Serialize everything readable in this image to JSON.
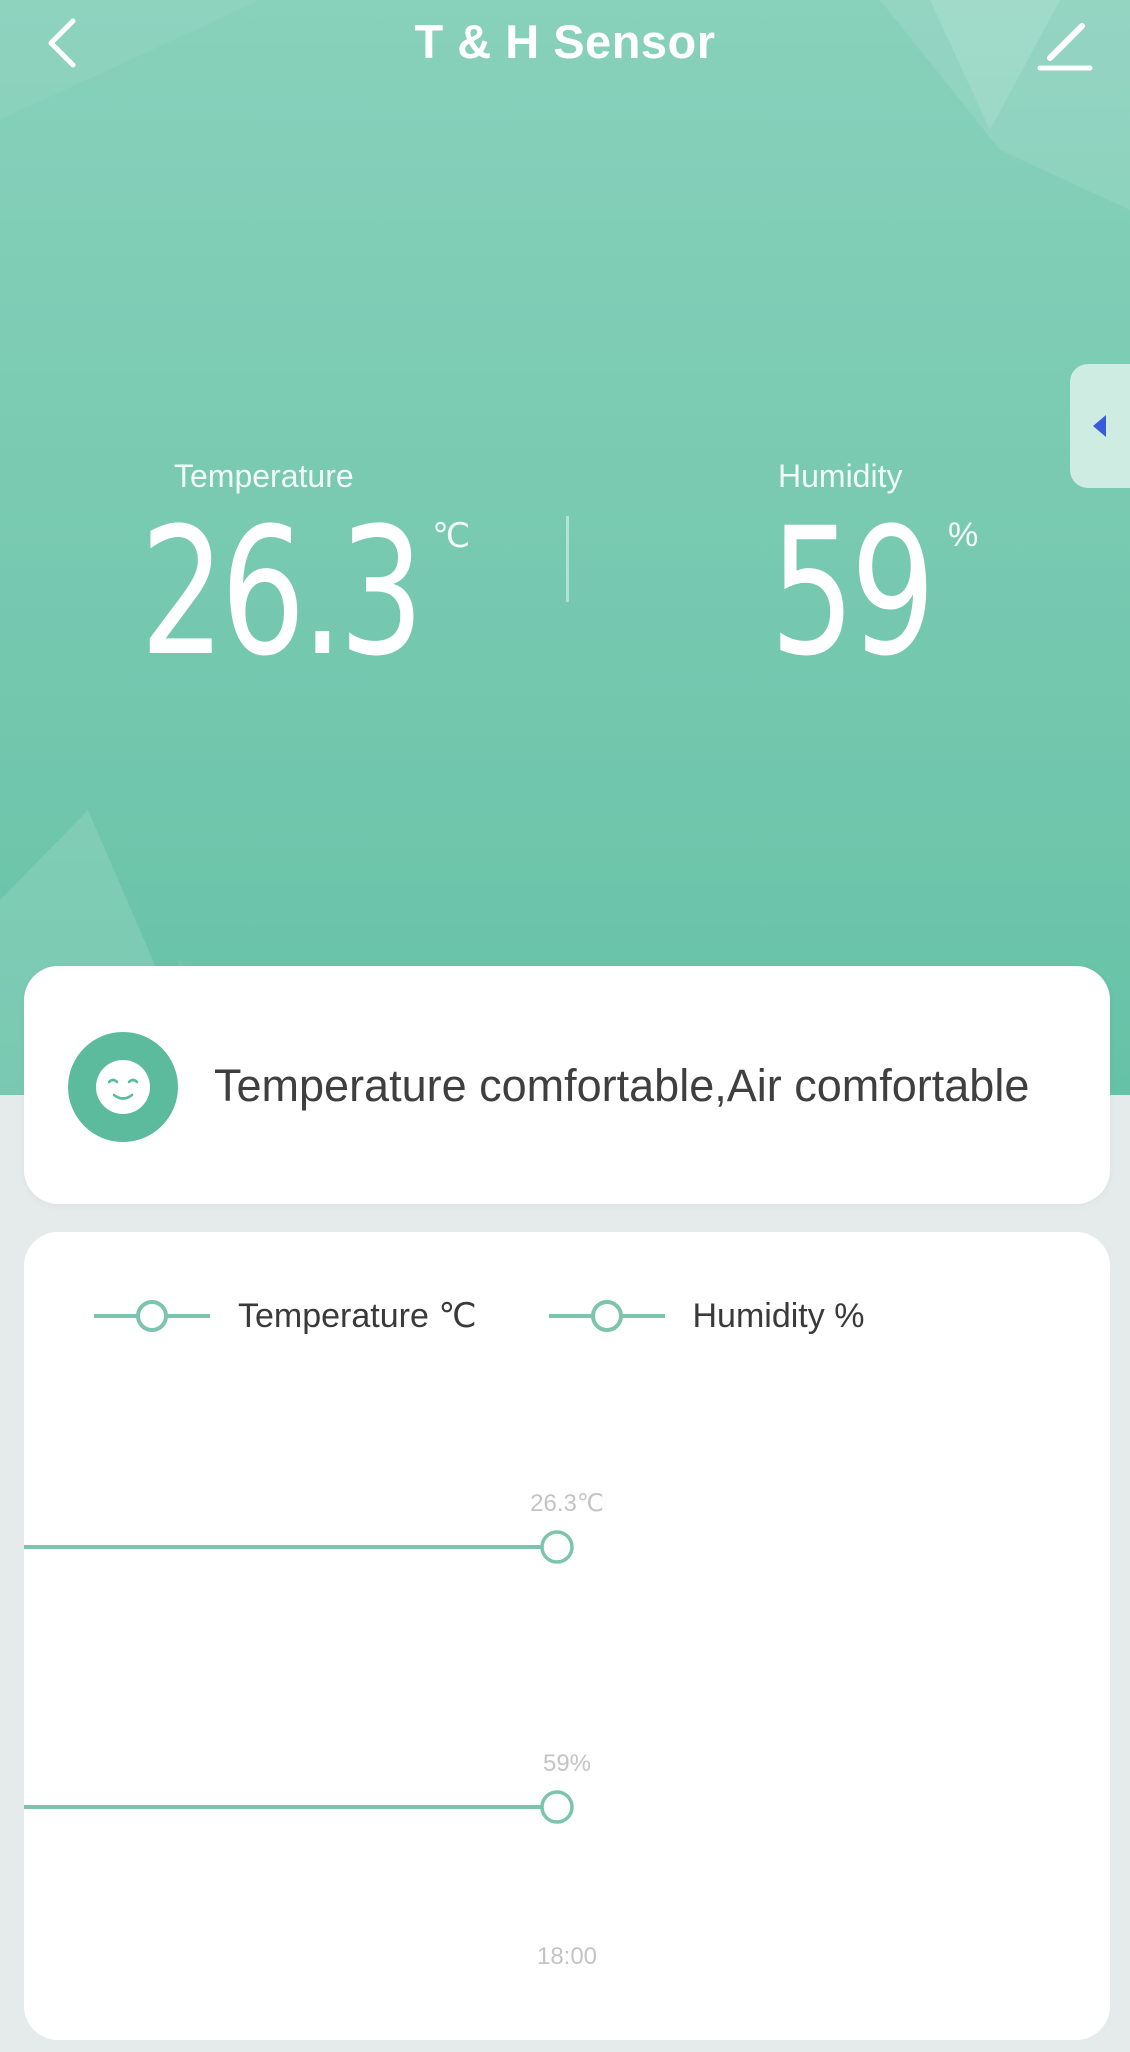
{
  "header": {
    "title": "T & H Sensor",
    "back_icon": "chevron-left-icon",
    "edit_icon": "pencil-icon",
    "side_tab_icon": "caret-left-icon"
  },
  "readings": {
    "temperature": {
      "label": "Temperature",
      "value": "26.3",
      "unit": "℃"
    },
    "humidity": {
      "label": "Humidity",
      "value": "59",
      "unit": "%"
    }
  },
  "comfort": {
    "icon": "smiley-face-icon",
    "text": "Temperature comfortable,Air comfortable"
  },
  "chart": {
    "legend": [
      {
        "label": "Temperature ℃"
      },
      {
        "label": "Humidity %"
      }
    ]
  },
  "chart_data": {
    "type": "line",
    "series": [
      {
        "name": "Temperature ℃",
        "x": [
          "18:00"
        ],
        "values": [
          26.3
        ],
        "point_label": "26.3℃"
      },
      {
        "name": "Humidity %",
        "x": [
          "18:00"
        ],
        "values": [
          59
        ],
        "point_label": "59%"
      }
    ],
    "x_tick_labels": [
      "18:00"
    ],
    "grid": false,
    "legend_position": "top-left"
  },
  "colors": {
    "accent": "#5bbb9c",
    "line": "#7cc4ad",
    "hero_top": "#88d1bb",
    "hero_bottom": "#66c2a6",
    "side_tab_arrow": "#3b5bdb",
    "muted_text": "#c4c4c4"
  }
}
